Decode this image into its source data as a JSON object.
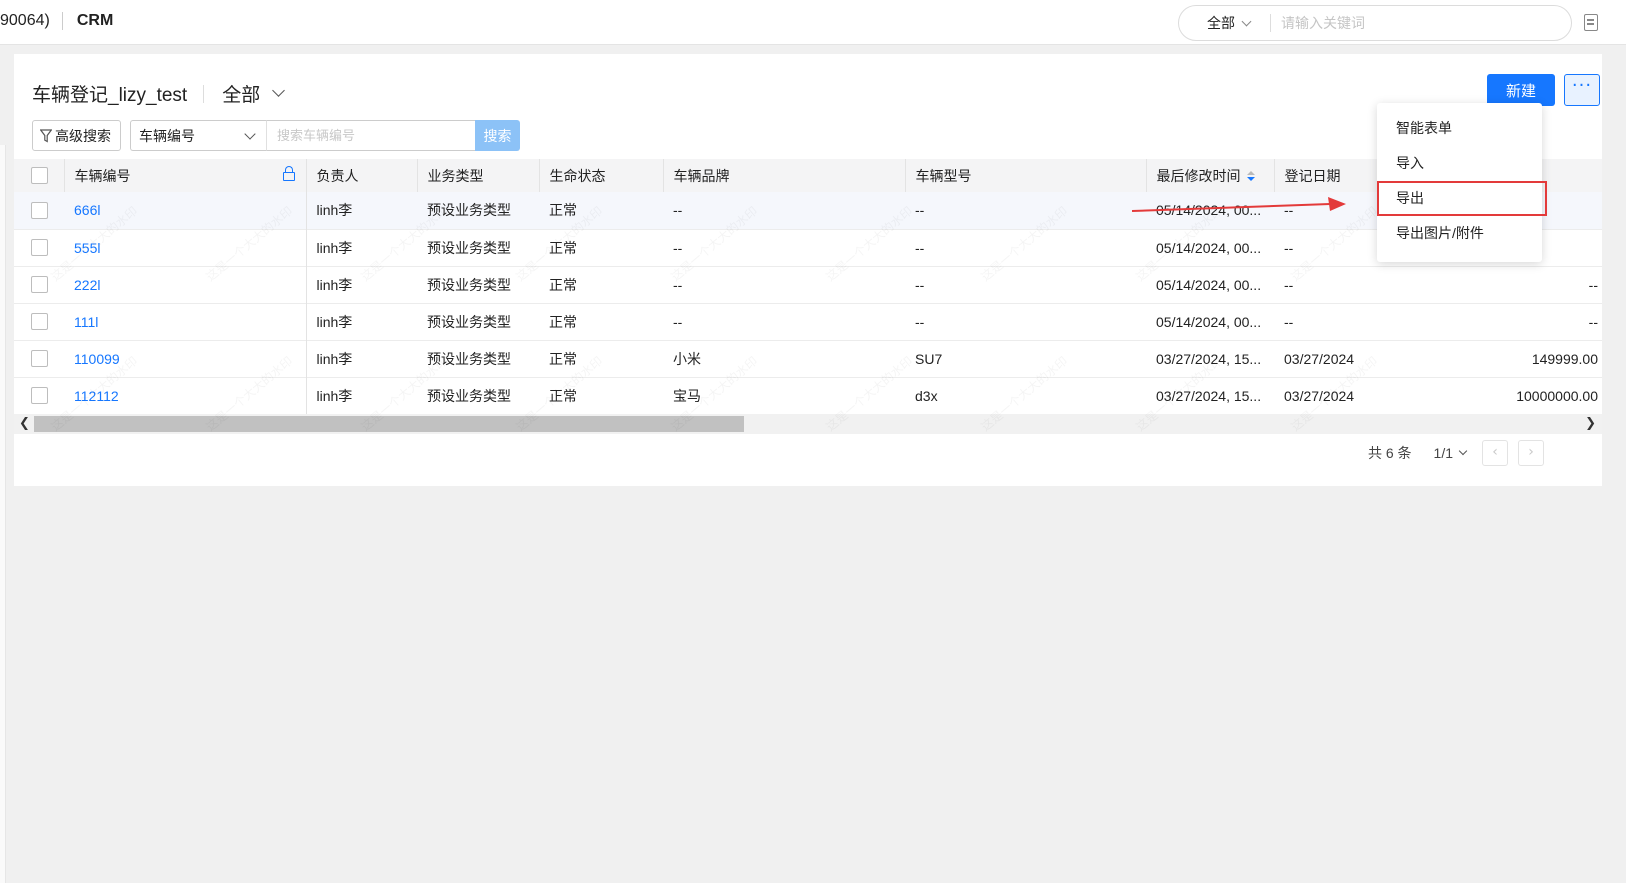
{
  "topbar": {
    "partial_title": "90064)",
    "app_name": "CRM",
    "search_scope": "全部",
    "search_placeholder": "请输入关键词"
  },
  "page": {
    "title": "车辆登记_lizy_test",
    "scope": "全部",
    "new_button": "新建",
    "more_button": "···"
  },
  "filter": {
    "advanced_search": "高级搜索",
    "field": "车辆编号",
    "search_placeholder": "搜索车辆编号",
    "search_button": "搜索"
  },
  "table": {
    "columns": [
      "车辆编号",
      "负责人",
      "业务类型",
      "生命状态",
      "车辆品牌",
      "车辆型号",
      "最后修改时间",
      "登记日期"
    ],
    "rows": [
      {
        "id": "666l",
        "owner": "linh李",
        "biz": "预设业务类型",
        "status": "正常",
        "brand": "--",
        "model": "--",
        "modified": "05/14/2024, 00...",
        "reg": "--",
        "amount": ""
      },
      {
        "id": "555l",
        "owner": "linh李",
        "biz": "预设业务类型",
        "status": "正常",
        "brand": "--",
        "model": "--",
        "modified": "05/14/2024, 00...",
        "reg": "--",
        "amount": ""
      },
      {
        "id": "222l",
        "owner": "linh李",
        "biz": "预设业务类型",
        "status": "正常",
        "brand": "--",
        "model": "--",
        "modified": "05/14/2024, 00...",
        "reg": "--",
        "amount": "--"
      },
      {
        "id": "111l",
        "owner": "linh李",
        "biz": "预设业务类型",
        "status": "正常",
        "brand": "--",
        "model": "--",
        "modified": "05/14/2024, 00...",
        "reg": "--",
        "amount": "--"
      },
      {
        "id": "110099",
        "owner": "linh李",
        "biz": "预设业务类型",
        "status": "正常",
        "brand": "小米",
        "model": "SU7",
        "modified": "03/27/2024, 15...",
        "reg": "03/27/2024",
        "amount": "149999.00"
      },
      {
        "id": "112112",
        "owner": "linh李",
        "biz": "预设业务类型",
        "status": "正常",
        "brand": "宝马",
        "model": "d3x",
        "modified": "03/27/2024, 15...",
        "reg": "03/27/2024",
        "amount": "10000000.00"
      }
    ]
  },
  "pager": {
    "total": "共 6 条",
    "page": "1/1"
  },
  "more_menu": {
    "items": [
      "智能表单",
      "导入",
      "导出",
      "导出图片/附件"
    ],
    "highlighted": "导出"
  },
  "watermark": "这是一个大大的水印",
  "colors": {
    "primary": "#1677ff",
    "highlight_box": "#e33a3a"
  }
}
